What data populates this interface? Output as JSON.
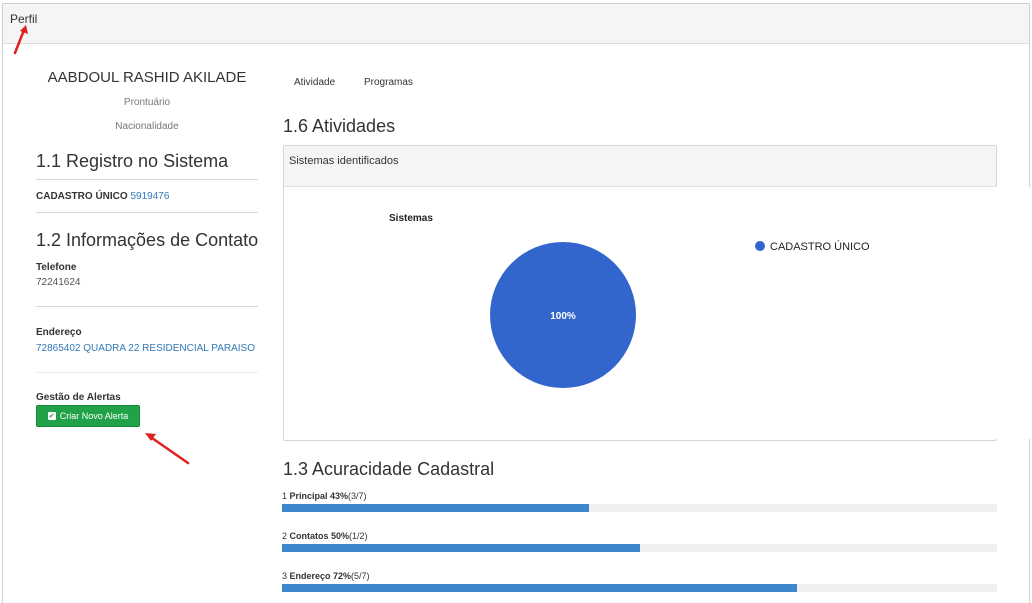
{
  "header": {
    "title": "Perfil"
  },
  "profile": {
    "name": "AABDOUL RASHID AKILADE",
    "prontuario": "Prontuário",
    "nacionalidade": "Nacionalidade"
  },
  "registro": {
    "title": "1.1 Registro no Sistema",
    "label": "CADASTRO ÚNICO",
    "value": "5919476"
  },
  "contato": {
    "title": "1.2 Informações de Contato",
    "telefone_label": "Telefone",
    "telefone_value": "72241624",
    "endereco_label": "Endereço",
    "endereco_value": "72865402 QUADRA 22 RESIDENCIAL PARAISO"
  },
  "alertas": {
    "label": "Gestão de Alertas",
    "button_label": "Criar Novo Alerta",
    "button_icon": "check-square-icon"
  },
  "tabs": [
    "Atividade",
    "Programas"
  ],
  "atividades": {
    "title": "1.6 Atividades",
    "panel_title": "Sistemas identificados"
  },
  "chart_data": {
    "type": "pie",
    "title": "Sistemas",
    "series": [
      {
        "name": "CADASTRO ÚNICO",
        "value": 100,
        "label": "100%",
        "color": "#3366cc"
      }
    ],
    "legend": "right"
  },
  "acuracidade": {
    "title": "1.3 Acuracidade Cadastral",
    "items": [
      {
        "prefix": "1",
        "name": "Principal",
        "percent": "43%",
        "ratio": "(3/7)",
        "value": 0.43
      },
      {
        "prefix": "2",
        "name": "Contatos",
        "percent": "50%",
        "ratio": "(1/2)",
        "value": 0.5
      },
      {
        "prefix": "3",
        "name": "Endereço",
        "percent": "72%",
        "ratio": "(5/7)",
        "value": 0.72
      }
    ]
  },
  "colors": {
    "accent": "#337ab7",
    "button_green": "#21a249",
    "progress_blue": "#3b87c9",
    "annotation_red": "#e02020"
  }
}
